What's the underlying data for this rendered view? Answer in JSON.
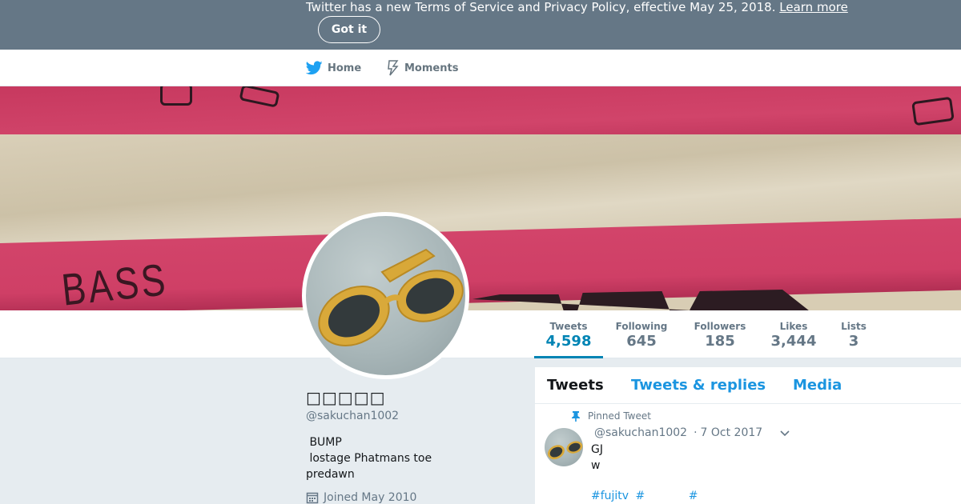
{
  "banner": {
    "text": "Twitter has a new Terms of Service and Privacy Policy, effective May 25, 2018.",
    "link_label": "Learn more",
    "button_label": "Got it"
  },
  "nav": {
    "home_label": "Home",
    "moments_label": "Moments"
  },
  "header_image": {
    "visible_text": "BASS"
  },
  "stats": [
    {
      "label": "Tweets",
      "value": "4,598",
      "active": true
    },
    {
      "label": "Following",
      "value": "645"
    },
    {
      "label": "Followers",
      "value": "185"
    },
    {
      "label": "Likes",
      "value": "3,444"
    },
    {
      "label": "Lists",
      "value": "3"
    }
  ],
  "profile": {
    "name": "□□□□□",
    "handle": "@sakuchan1002",
    "bio_lines": [
      " BUMP",
      " lostage Phatmans toe",
      "predawn"
    ],
    "joined": "Joined May 2010"
  },
  "timeline": {
    "tabs": [
      "Tweets",
      "Tweets & replies",
      "Media"
    ],
    "pinned_label": "Pinned Tweet",
    "tweet": {
      "handle": "@sakuchan1002",
      "date": "7 Oct 2017",
      "text_lines": [
        "GJ",
        "w"
      ],
      "hashtags": [
        "#fujitv",
        "#",
        "#"
      ]
    }
  },
  "colors": {
    "banner_bg": "#657786",
    "accent": "#1b95e0",
    "active_stat": "#0084b4",
    "page_bg": "#e6ecf0"
  },
  "icons": {
    "home": "twitter-bird-icon",
    "moments": "lightning-icon",
    "calendar": "calendar-icon",
    "pin": "pin-icon",
    "caret": "chevron-down-icon"
  }
}
